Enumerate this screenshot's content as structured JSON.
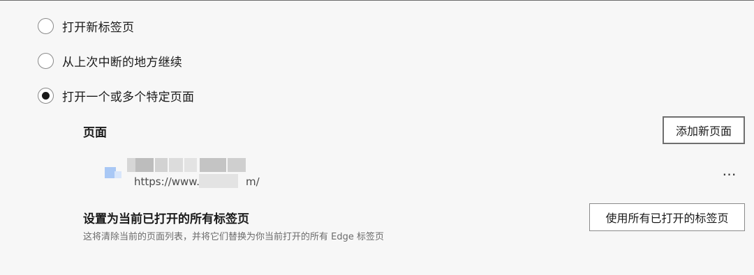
{
  "startup_options": [
    {
      "label": "打开新标签页",
      "checked": false
    },
    {
      "label": "从上次中断的地方继续",
      "checked": false
    },
    {
      "label": "打开一个或多个特定页面",
      "checked": true
    }
  ],
  "pages_section": {
    "title": "页面",
    "add_button": "添加新页面",
    "items": [
      {
        "url": "https://www.",
        "url_tail": "m/",
        "favicon": "website-favicon-icon",
        "more_icon": "…"
      }
    ]
  },
  "set_current": {
    "title": "设置为当前已打开的所有标签页",
    "description": "这将清除当前的页面列表，并将它们替换为你当前打开的所有 Edge 标签页",
    "button": "使用所有已打开的标签页"
  },
  "colors": {
    "background": "#f7f7f7",
    "text": "#1a1a1a",
    "muted": "#6b6b6b",
    "border": "#8a8a8a"
  }
}
